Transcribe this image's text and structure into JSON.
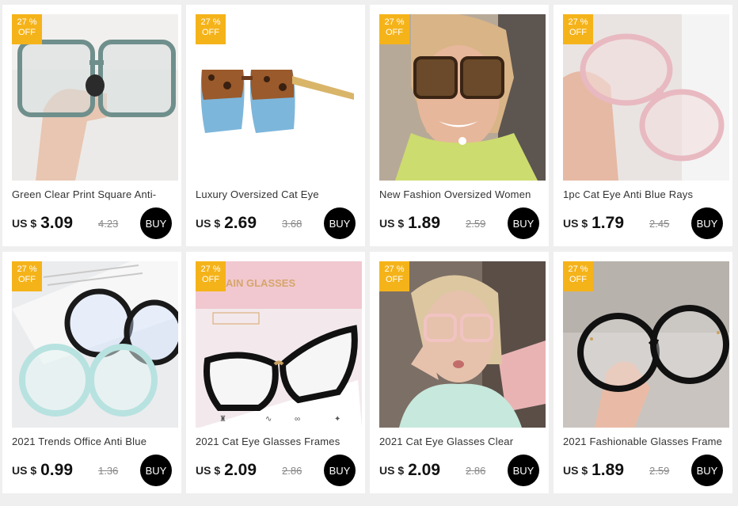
{
  "badge_color": "#f5b31a",
  "products": [
    {
      "title": "Green Clear Print Square Anti-",
      "currency": "US $",
      "price": "3.09",
      "original": "4.23",
      "discount_pct": "27 %",
      "discount_off": "OFF",
      "buy": "BUY"
    },
    {
      "title": "Luxury Oversized Cat Eye",
      "currency": "US $",
      "price": "2.69",
      "original": "3.68",
      "discount_pct": "27 %",
      "discount_off": "OFF",
      "buy": "BUY"
    },
    {
      "title": "New Fashion Oversized Women",
      "currency": "US $",
      "price": "1.89",
      "original": "2.59",
      "discount_pct": "27 %",
      "discount_off": "OFF",
      "buy": "BUY"
    },
    {
      "title": "1pc Cat Eye Anti Blue Rays",
      "currency": "US $",
      "price": "1.79",
      "original": "2.45",
      "discount_pct": "27 %",
      "discount_off": "OFF",
      "buy": "BUY"
    },
    {
      "title": "2021 Trends Office Anti Blue",
      "currency": "US $",
      "price": "0.99",
      "original": "1.36",
      "discount_pct": "27 %",
      "discount_off": "OFF",
      "buy": "BUY"
    },
    {
      "title": "2021 Cat Eye Glasses Frames",
      "currency": "US $",
      "price": "2.09",
      "original": "2.86",
      "discount_pct": "27 %",
      "discount_off": "OFF",
      "buy": "BUY",
      "image_text": "AIN GLASSES"
    },
    {
      "title": "2021 Cat Eye Glasses Clear",
      "currency": "US $",
      "price": "2.09",
      "original": "2.86",
      "discount_pct": "27 %",
      "discount_off": "OFF",
      "buy": "BUY"
    },
    {
      "title": "2021 Fashionable  Glasses Frame",
      "currency": "US $",
      "price": "1.89",
      "original": "2.59",
      "discount_pct": "27 %",
      "discount_off": "OFF",
      "buy": "BUY"
    }
  ]
}
